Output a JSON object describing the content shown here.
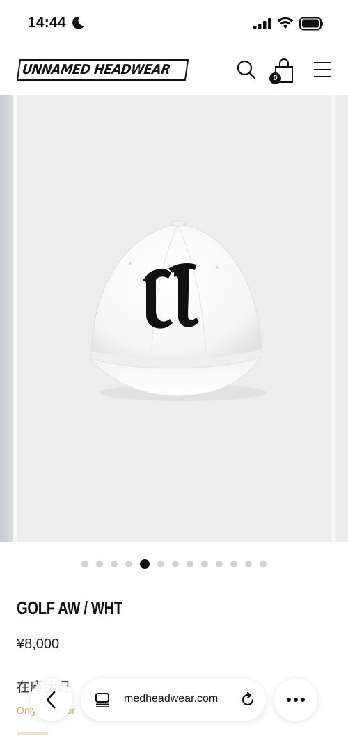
{
  "status_bar": {
    "time": "14:44",
    "icons": [
      "moon-icon",
      "signal-icon",
      "wifi-icon",
      "battery-icon"
    ]
  },
  "header": {
    "logo_text": "UNNAMED HEADWEAR",
    "cart_count": "0",
    "icons": [
      "search-icon",
      "shopping-bag-icon",
      "menu-icon"
    ]
  },
  "gallery": {
    "slide_count": 13,
    "active_index": 4,
    "image": "white-cap-with-black-U-logo"
  },
  "product": {
    "title": "GOLF AW / WHT",
    "price": "¥8,000",
    "stock_label": "在庫状況",
    "stock_note": "Only ... Order"
  },
  "browser": {
    "url": "unnamedheadwear.com",
    "url_visible": "medheadwear.com",
    "icons": [
      "back-chevron-icon",
      "tabs-icon",
      "reload-icon",
      "more-icon"
    ]
  },
  "colors": {
    "accent_gold": "#c9b26a",
    "text_dark": "#111111",
    "gallery_bg": "#ededed",
    "dot_inactive": "#d2d2d2"
  }
}
